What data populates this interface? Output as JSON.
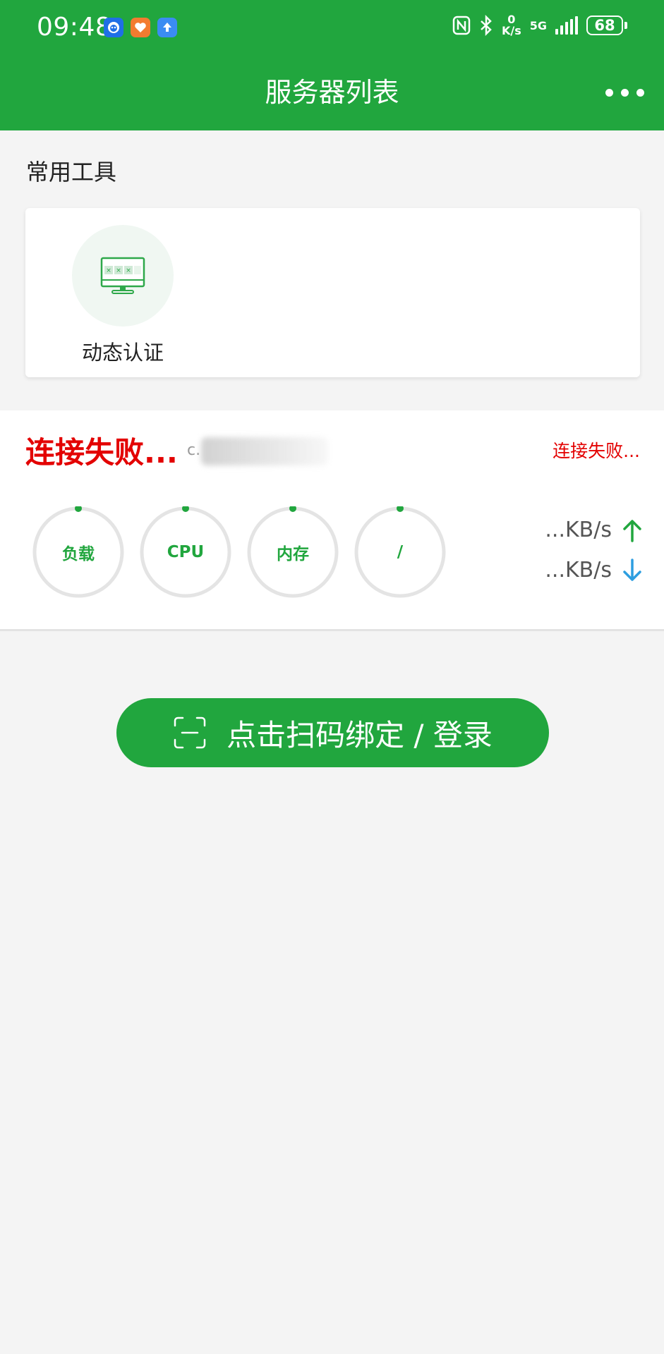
{
  "status_bar": {
    "time": "09:48",
    "net_speed_value": "0",
    "net_speed_unit": "K/s",
    "network_type": "5G",
    "battery": "68",
    "app_icons": [
      "robot-app-icon",
      "health-app-icon",
      "upload-app-icon"
    ]
  },
  "header": {
    "title": "服务器列表"
  },
  "tools": {
    "section_title": "常用工具",
    "items": [
      {
        "label": "动态认证",
        "icon": "monitor-password-icon"
      }
    ]
  },
  "server": {
    "status": "连接失败...",
    "host": "c.",
    "status_right": "连接失败...",
    "gauges": [
      {
        "label": "负载",
        "percent": 0
      },
      {
        "label": "CPU",
        "percent": 0
      },
      {
        "label": "内存",
        "percent": 0
      },
      {
        "label": "/",
        "percent": 0
      }
    ],
    "upload_speed": "...KB/s",
    "download_speed": "...KB/s"
  },
  "scan_button": {
    "label": "点击扫码绑定 / 登录"
  },
  "colors": {
    "primary": "#21a63e",
    "error": "#e30000",
    "upload_arrow": "#21a63e",
    "download_arrow": "#2d9ee0",
    "page_bg": "#f4f4f4"
  }
}
